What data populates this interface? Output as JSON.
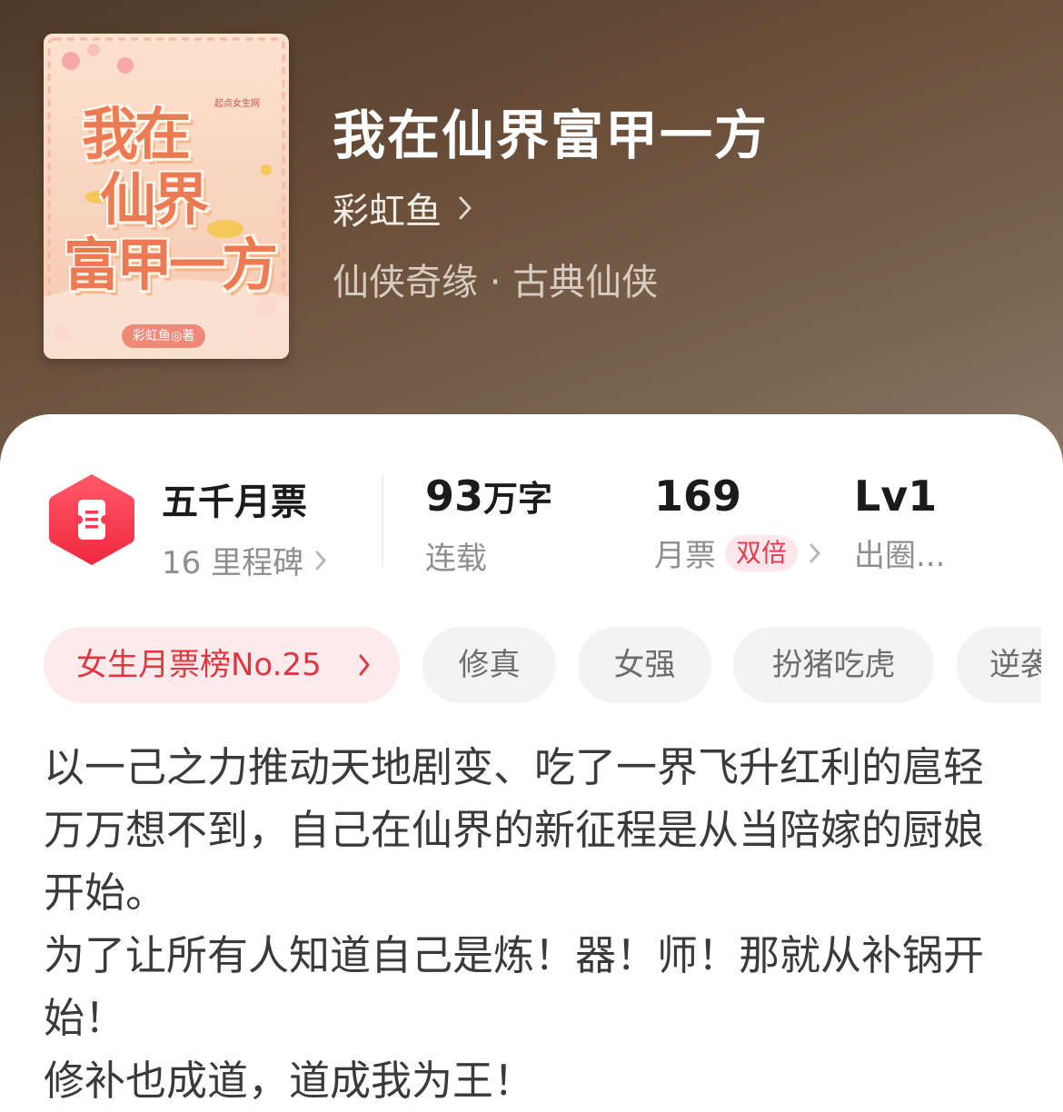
{
  "book": {
    "cover": {
      "title_line1": "我在",
      "title_line2": "仙界",
      "title_line3": "富甲一方",
      "author_tag": "彩虹鱼◎著",
      "brand": "起点女生网"
    },
    "title": "我在仙界富甲一方",
    "author": "彩虹鱼",
    "genre": "仙侠奇缘 · 古典仙侠"
  },
  "stats": {
    "ticket_rank_title": "五千月票",
    "milestone": "16 里程碑",
    "word_count_number": "93",
    "word_count_unit": "万字",
    "status": "连载",
    "monthly_tickets_number": "169",
    "monthly_tickets_label": "月票",
    "double_badge": "双倍",
    "level": "Lv1",
    "level_label": "出圈..."
  },
  "tags": {
    "rank": "女生月票榜No.25",
    "items": [
      "修真",
      "女强",
      "扮猪吃虎",
      "逆袭"
    ]
  },
  "synopsis": {
    "lines": [
      "以一己之力推动天地剧变、吃了一界飞升红利的扈轻",
      "万万想不到，自己在仙界的新征程是从当陪嫁的厨娘",
      "开始。",
      "为了让所有人知道自己是炼！器！师！那就从补锅开",
      "始！",
      "修补也成道，道成我为王！"
    ]
  },
  "colors": {
    "header_bg": "#5e4634",
    "accent_red": "#e83a4f",
    "rank_tag_bg": "#fdeaec"
  }
}
